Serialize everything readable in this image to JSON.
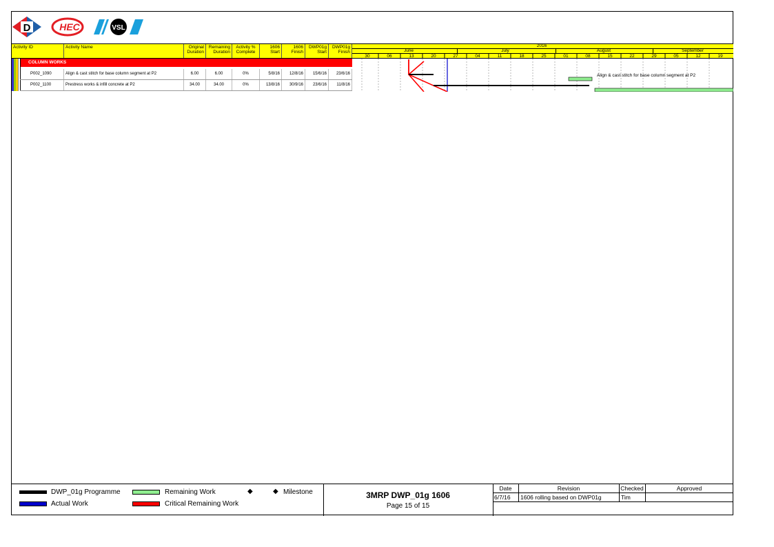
{
  "header_columns": [
    {
      "id": "activity_id",
      "label": "Activity ID"
    },
    {
      "id": "activity_name",
      "label": "Activity Name"
    },
    {
      "id": "orig_dur",
      "label": "Original Duration"
    },
    {
      "id": "rem_dur",
      "label": "Remaining Duration"
    },
    {
      "id": "pct",
      "label": "Activity % Complete"
    },
    {
      "id": "s1606",
      "label": "1606 Start"
    },
    {
      "id": "f1606",
      "label": "1606 Finish"
    },
    {
      "id": "sdwp",
      "label": "DWP01g Start"
    },
    {
      "id": "fdwp",
      "label": "DWP01g Finish"
    }
  ],
  "wbs_label": "COLUMN WORKS",
  "activities": [
    {
      "id": "P002_1090",
      "name": "Align & cast stitch for base column segment at P2",
      "orig": "6.00",
      "rem": "6.00",
      "pct": "0%",
      "s1606": "5/8/16",
      "f1606": "12/8/16",
      "sdwp": "15/6/16",
      "fdwp": "23/6/16"
    },
    {
      "id": "P002_1100",
      "name": "Prestress works & infill concrete at P2",
      "orig": "34.00",
      "rem": "34.00",
      "pct": "0%",
      "s1606": "13/8/16",
      "f1606": "30/9/16",
      "sdwp": "23/6/16",
      "fdwp": "11/8/16"
    }
  ],
  "timeline": {
    "year": "2016",
    "months": [
      "June",
      "July",
      "August",
      "September"
    ],
    "weeks": [
      "30",
      "06",
      "13",
      "20",
      "27",
      "04",
      "11",
      "18",
      "25",
      "01",
      "08",
      "15",
      "22",
      "29",
      "05",
      "12",
      "19"
    ]
  },
  "bar_label": "Align & cast stitch for base column segment at P2",
  "legend": {
    "programme": "DWP_01g Programme",
    "remaining": "Remaining Work",
    "milestone": "Milestone",
    "actual": "Actual Work",
    "critical": "Critical Remaining Work"
  },
  "title_block": {
    "title": "3MRP DWP_01g 1606",
    "page": "Page 15 of 15"
  },
  "revision": {
    "headers": {
      "date": "Date",
      "revision": "Revision",
      "checked": "Checked",
      "approved": "Approved"
    },
    "row": {
      "date": "6/7/16",
      "revision": "1606 rolling based on DWP01g",
      "checked": "Tim",
      "approved": ""
    }
  },
  "colors": {
    "header": "#ffff00",
    "wbs": "#ff0000",
    "remaining": "#90ee90",
    "critical": "#ff0000",
    "actual": "#0000cc",
    "programme": "#000000"
  }
}
